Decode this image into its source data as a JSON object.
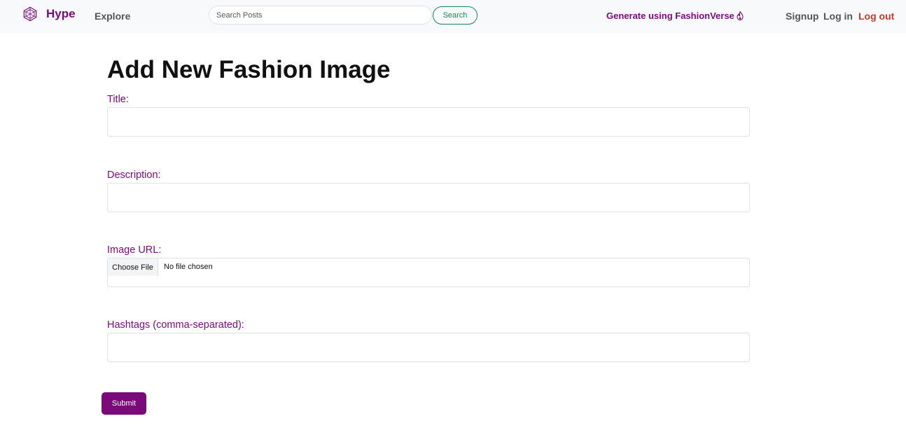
{
  "brand": {
    "name": "Hype",
    "logo_icon": "hexagon-wireframe-icon",
    "color": "#7a0a7a"
  },
  "nav": {
    "explore_label": "Explore",
    "generate_label": "Generate using FashionVerse",
    "generate_icon": "flame-icon",
    "signup_label": "Signup",
    "login_label": "Log in",
    "logout_label": "Log out"
  },
  "search": {
    "placeholder": "Search Posts",
    "value": "",
    "button_label": "Search"
  },
  "page": {
    "title": "Add New Fashion Image"
  },
  "form": {
    "title_label": "Title:",
    "title_value": "",
    "description_label": "Description:",
    "description_value": "",
    "image_label": "Image URL:",
    "file_button_label": "Choose File",
    "file_status": "No file chosen",
    "hashtags_label": "Hashtags (comma-separated):",
    "hashtags_value": "",
    "submit_label": "Submit"
  },
  "colors": {
    "accent": "#7a0a7a",
    "search_outline": "#198754",
    "logout": "#c0392b",
    "navbar_bg": "#f8f9fa"
  }
}
